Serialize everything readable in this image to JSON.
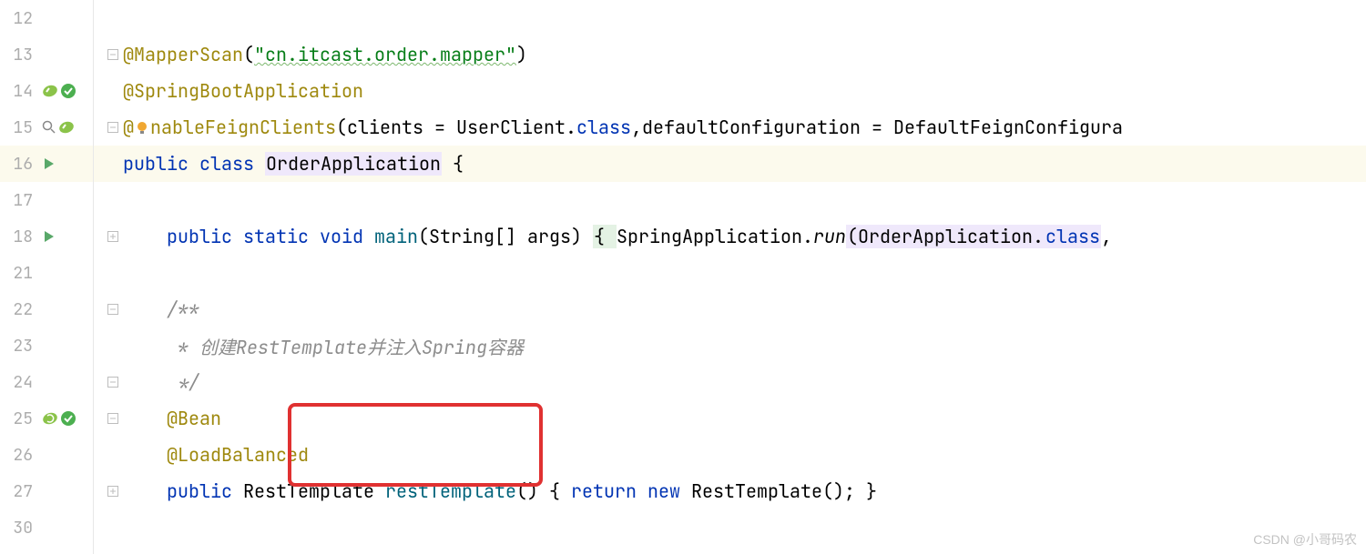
{
  "lines": {
    "12": "12",
    "13": "13",
    "14": "14",
    "15": "15",
    "16": "16",
    "17": "17",
    "18": "18",
    "21": "21",
    "22": "22",
    "23": "23",
    "24": "24",
    "25": "25",
    "26": "26",
    "27": "27",
    "30": "30"
  },
  "code": {
    "l13_annotation": "@MapperScan",
    "l13_paren_open": "(",
    "l13_string": "\"cn.itcast.order.mapper\"",
    "l13_paren_close": ")",
    "l14_annotation": "@SpringBootApplication",
    "l15_annotation": "@",
    "l15_annotation2": "nableFeignClients",
    "l15_p1": "(clients = UserClient.",
    "l15_class1": "class",
    "l15_p2": ",defaultConfiguration = DefaultFeignConfigura",
    "l16_public": "public ",
    "l16_class": "class ",
    "l16_name": "OrderApplication",
    "l16_brace": " {",
    "l18_public": "public ",
    "l18_static": "static ",
    "l18_void": "void ",
    "l18_main": "main",
    "l18_params": "(String[] args) ",
    "l18_brace": "{ ",
    "l18_springapp": "SpringApplication.",
    "l18_run": "run",
    "l18_p2": "(OrderApplication.",
    "l18_class": "class",
    "l18_p3": ", ",
    "l22_comment": "/**",
    "l23_comment": " * 创建RestTemplate并注入Spring容器",
    "l24_comment": " */",
    "l25_annotation": "@Bean",
    "l26_annotation": "@LoadBalanced",
    "l27_public": "public ",
    "l27_type": "RestTemplate ",
    "l27_method": "restTemplate",
    "l27_p1": "() { ",
    "l27_return": "return ",
    "l27_new": "new ",
    "l27_type2": "RestTemplate",
    "l27_p2": "(); }"
  },
  "watermark": "CSDN @小哥码农"
}
